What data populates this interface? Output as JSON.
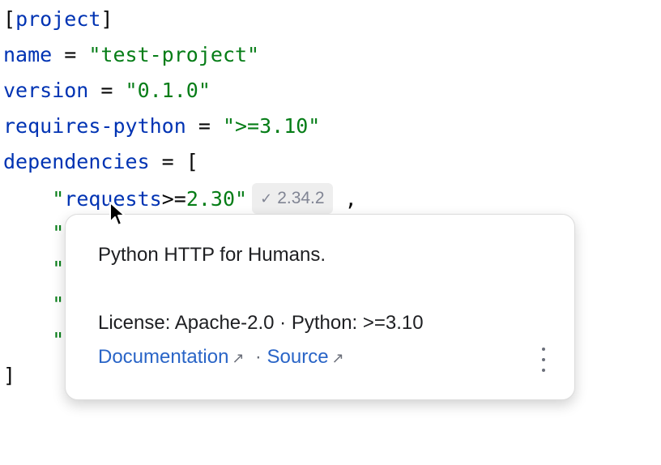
{
  "code": {
    "section": "project",
    "name_key": "name",
    "name_value": "\"test-project\"",
    "version_key": "version",
    "version_value": "\"0.1.0\"",
    "requires_key": "requires-python",
    "requires_value": "\">=3.10\"",
    "deps_key": "dependencies",
    "deps_open": "[",
    "dep1_quote_open": "\"",
    "dep1_name": "requests",
    "dep1_op": ">=",
    "dep1_version": "2.30",
    "dep1_quote_close": "\"",
    "dep1_comma": ",",
    "hidden_line_quote": "\"",
    "deps_close": "]"
  },
  "inlay_hint": {
    "check_icon": "check-icon",
    "version": "2.34.2"
  },
  "popup": {
    "description": "Python HTTP for Humans.",
    "license_line": "License: Apache-2.0 · Python: >=3.10",
    "doc_link": "Documentation",
    "separator": "·",
    "source_link": "Source",
    "arrow": "↗"
  },
  "colors": {
    "keyword": "#0033b3",
    "string": "#067d17",
    "link": "#2a65c7"
  }
}
